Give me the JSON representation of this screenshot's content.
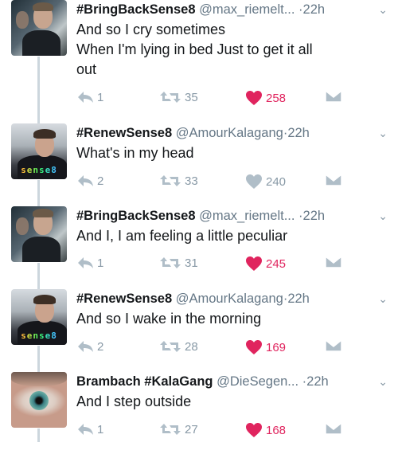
{
  "colors": {
    "like": "#e0245e",
    "muted": "#8899a6",
    "handle": "#657786",
    "text": "#14171a",
    "thread": "#ccd6dd"
  },
  "tweets": [
    {
      "avatar": "max-riemelt-avatar",
      "name": "#BringBackSense8",
      "handle": "@max_riemelt...",
      "dot": "·",
      "time": "22h",
      "lines": [
        "And so I cry sometimes",
        "When I'm lying in bed Just to get it all",
        "out"
      ],
      "replies": "1",
      "retweets": "35",
      "likes": "258",
      "liked": true
    },
    {
      "avatar": "amour-kalagang-avatar",
      "avatar_text": "sense8",
      "name": "#RenewSense8",
      "handle": "@AmourKalagang",
      "dot": "·",
      "time": "22h",
      "lines": [
        "What's in my head"
      ],
      "replies": "2",
      "retweets": "33",
      "likes": "240",
      "liked": false
    },
    {
      "avatar": "max-riemelt-avatar",
      "name": "#BringBackSense8",
      "handle": "@max_riemelt...",
      "dot": "·",
      "time": "22h",
      "lines": [
        "And I, I am feeling a little peculiar"
      ],
      "replies": "1",
      "retweets": "31",
      "likes": "245",
      "liked": true
    },
    {
      "avatar": "amour-kalagang-avatar",
      "avatar_text": "sense8",
      "name": "#RenewSense8",
      "handle": "@AmourKalagang",
      "dot": "·",
      "time": "22h",
      "lines": [
        "And so I wake in the morning"
      ],
      "replies": "2",
      "retweets": "28",
      "likes": "169",
      "liked": true
    },
    {
      "avatar": "eye-avatar",
      "name": "Brambach #KalaGang",
      "handle": "@DieSegen...",
      "dot": "·",
      "time": "22h",
      "lines": [
        "And I step outside"
      ],
      "replies": "1",
      "retweets": "27",
      "likes": "168",
      "liked": true
    }
  ]
}
